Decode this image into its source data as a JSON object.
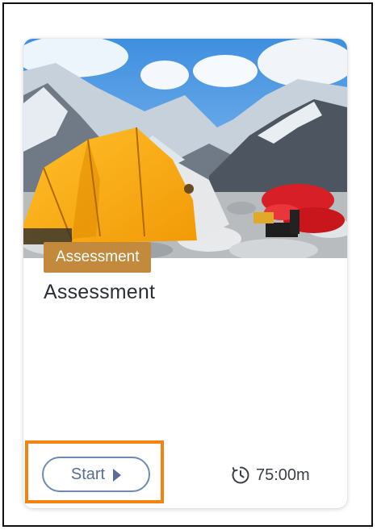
{
  "card": {
    "image_alt": "Tent and gear at mountain base camp",
    "tag_label": "Assessment",
    "title": "Assessment",
    "start_label": "Start",
    "start_icon": "play-icon",
    "duration_icon": "timer-icon",
    "duration": "75:00m"
  },
  "colors": {
    "tag_bg": "#c38a3d",
    "button_border": "#7289b5",
    "highlight": "#f5830f"
  }
}
